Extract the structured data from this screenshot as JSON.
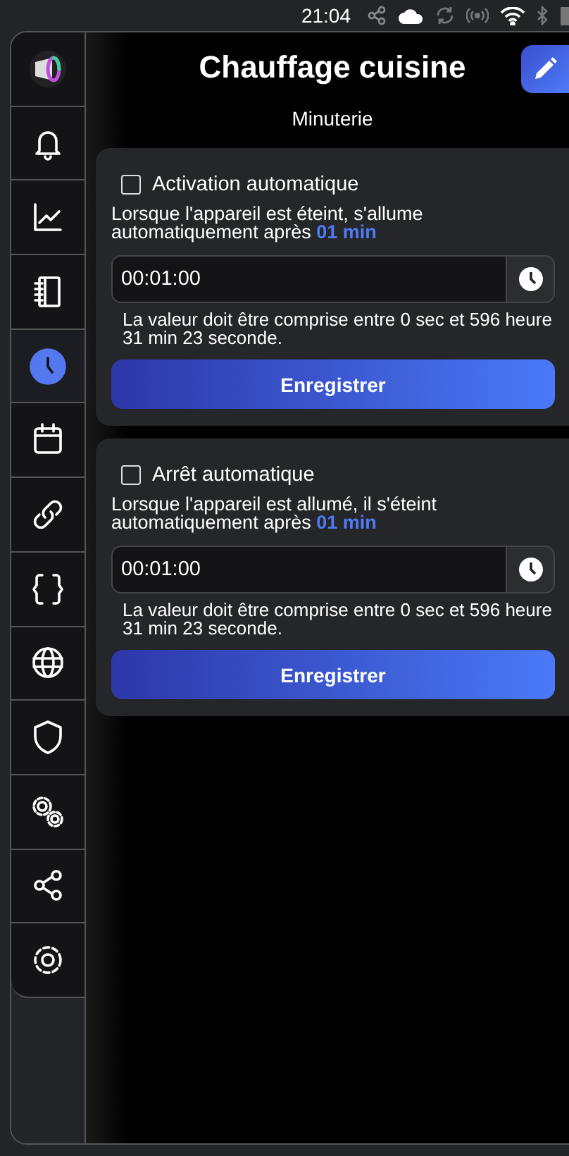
{
  "status_bar": {
    "time": "21:04"
  },
  "header": {
    "title": "Chauffage cuisine",
    "subtitle": "Minuterie"
  },
  "sidebar": {
    "items": [
      {
        "selected": false
      },
      {
        "selected": false
      },
      {
        "selected": false
      },
      {
        "selected": false
      },
      {
        "selected": true
      },
      {
        "selected": false
      },
      {
        "selected": false
      },
      {
        "selected": false
      },
      {
        "selected": false
      },
      {
        "selected": false
      },
      {
        "selected": false
      },
      {
        "selected": false
      },
      {
        "selected": false
      }
    ]
  },
  "sections": [
    {
      "label": "Activation automatique",
      "checked": false,
      "description": "Lorsque l'appareil est éteint, s'allume automatiquement après",
      "duration": "01 min",
      "value": "00:01:00",
      "hint": "La valeur doit être comprise entre 0 sec et 596 heure 31 min 23 seconde.",
      "button": "Enregistrer"
    },
    {
      "label": "Arrêt automatique",
      "checked": false,
      "description": "Lorsque l'appareil est allumé, il s'éteint automatiquement après",
      "duration": "01 min",
      "value": "00:01:00",
      "hint": "La valeur doit être comprise entre 0 sec et 596 heure 31 min 23 seconde.",
      "button": "Enregistrer"
    }
  ]
}
